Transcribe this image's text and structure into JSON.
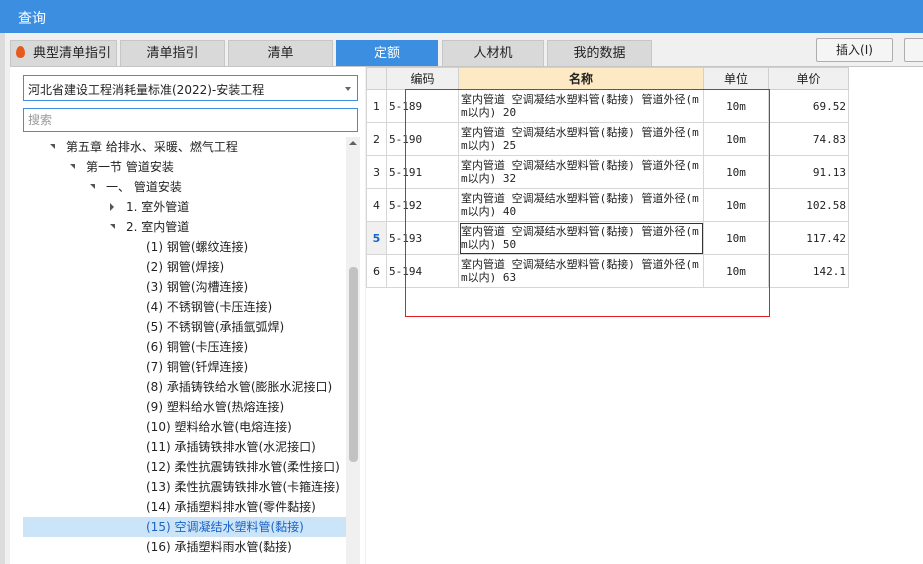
{
  "window": {
    "title": "查询"
  },
  "tabs": [
    {
      "label": "典型清单指引",
      "active": false,
      "icon": "flame-icon"
    },
    {
      "label": "清单指引",
      "active": false
    },
    {
      "label": "清单",
      "active": false
    },
    {
      "label": "定额",
      "active": true
    },
    {
      "label": "人材机",
      "active": false
    },
    {
      "label": "我的数据",
      "active": false
    }
  ],
  "toolbar": {
    "insert_label": "插入(I)"
  },
  "library": {
    "selected": "河北省建设工程消耗量标准(2022)-安装工程"
  },
  "search": {
    "placeholder": "搜索",
    "value": ""
  },
  "tree": [
    {
      "label": "第五章 给排水、采暖、燃气工程",
      "level": 0,
      "state": "open"
    },
    {
      "label": "第一节 管道安装",
      "level": 1,
      "state": "open"
    },
    {
      "label": "一、 管道安装",
      "level": 2,
      "state": "open"
    },
    {
      "label": "1. 室外管道",
      "level": 3,
      "state": "closed"
    },
    {
      "label": "2. 室内管道",
      "level": 3,
      "state": "open"
    },
    {
      "label": "(1) 钢管(螺纹连接)",
      "level": 4,
      "state": "leaf"
    },
    {
      "label": "(2) 钢管(焊接)",
      "level": 4,
      "state": "leaf"
    },
    {
      "label": "(3) 钢管(沟槽连接)",
      "level": 4,
      "state": "leaf"
    },
    {
      "label": "(4) 不锈钢管(卡压连接)",
      "level": 4,
      "state": "leaf"
    },
    {
      "label": "(5) 不锈钢管(承插氩弧焊)",
      "level": 4,
      "state": "leaf"
    },
    {
      "label": "(6) 铜管(卡压连接)",
      "level": 4,
      "state": "leaf"
    },
    {
      "label": "(7) 铜管(钎焊连接)",
      "level": 4,
      "state": "leaf"
    },
    {
      "label": "(8) 承插铸铁给水管(膨胀水泥接口)",
      "level": 4,
      "state": "leaf"
    },
    {
      "label": "(9) 塑料给水管(热熔连接)",
      "level": 4,
      "state": "leaf"
    },
    {
      "label": "(10) 塑料给水管(电熔连接)",
      "level": 4,
      "state": "leaf"
    },
    {
      "label": "(11) 承插铸铁排水管(水泥接口)",
      "level": 4,
      "state": "leaf"
    },
    {
      "label": "(12) 柔性抗震铸铁排水管(柔性接口)",
      "level": 4,
      "state": "leaf"
    },
    {
      "label": "(13) 柔性抗震铸铁排水管(卡箍连接)",
      "level": 4,
      "state": "leaf"
    },
    {
      "label": "(14) 承插塑料排水管(零件黏接)",
      "level": 4,
      "state": "leaf"
    },
    {
      "label": "(15) 空调凝结水塑料管(黏接)",
      "level": 4,
      "state": "leaf",
      "selected": true
    },
    {
      "label": "(16) 承插塑料雨水管(黏接)",
      "level": 4,
      "state": "leaf"
    }
  ],
  "grid": {
    "headers": {
      "code": "编码",
      "name": "名称",
      "unit": "单位",
      "price": "单价"
    },
    "rows": [
      {
        "no": "1",
        "code": "5-189",
        "name": "室内管道 空调凝结水塑料管(黏接) 管道外径(mm以内) 20",
        "unit": "10m",
        "price": "69.52"
      },
      {
        "no": "2",
        "code": "5-190",
        "name": "室内管道 空调凝结水塑料管(黏接) 管道外径(mm以内) 25",
        "unit": "10m",
        "price": "74.83"
      },
      {
        "no": "3",
        "code": "5-191",
        "name": "室内管道 空调凝结水塑料管(黏接) 管道外径(mm以内) 32",
        "unit": "10m",
        "price": "91.13"
      },
      {
        "no": "4",
        "code": "5-192",
        "name": "室内管道 空调凝结水塑料管(黏接) 管道外径(mm以内) 40",
        "unit": "10m",
        "price": "102.58"
      },
      {
        "no": "5",
        "code": "5-193",
        "name": "室内管道 空调凝结水塑料管(黏接) 管道外径(mm以内) 50",
        "unit": "10m",
        "price": "117.42",
        "selected": true
      },
      {
        "no": "6",
        "code": "5-194",
        "name": "室内管道 空调凝结水塑料管(黏接) 管道外径(mm以内) 63",
        "unit": "10m",
        "price": "142.1"
      }
    ]
  },
  "colors": {
    "accent": "#3c8fe0",
    "highlight_box": "#e02020",
    "header_name_bg": "#fde9c4",
    "selected_row_bg": "#cce4f7"
  }
}
